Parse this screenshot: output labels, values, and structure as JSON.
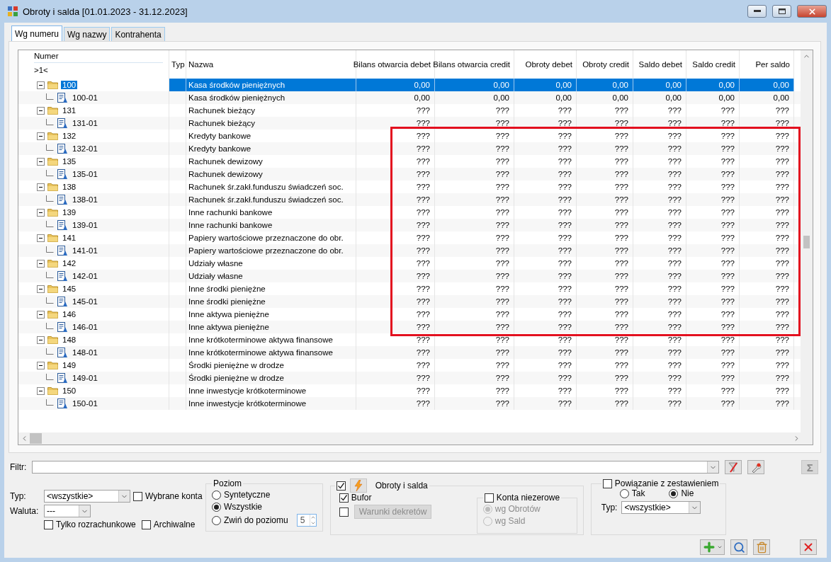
{
  "window": {
    "title": "Obroty i salda [01.01.2023 - 31.12.2023]"
  },
  "tabs": [
    {
      "label": "Wg numeru",
      "selected": true
    },
    {
      "label": "Wg nazwy",
      "selected": false
    },
    {
      "label": "Kontrahenta",
      "selected": false
    }
  ],
  "table": {
    "columns": [
      "Numer",
      "Typ",
      "Nazwa",
      "Bilans otwarcia debet",
      "Bilans otwarcia credit",
      "Obroty debet",
      "Obroty credit",
      "Saldo debet",
      "Saldo credit",
      "Per saldo"
    ],
    "number_filter": ">1<",
    "rows": [
      {
        "number": "100",
        "name": "Kasa środków pieniężnych",
        "values": [
          "0,00",
          "0,00",
          "0,00",
          "0,00",
          "0,00",
          "0,00",
          "0,00"
        ],
        "expanded": true,
        "selected": true,
        "highlighted": false,
        "children": [
          {
            "number": "100-01",
            "name": "Kasa środków pieniężnych",
            "values": [
              "0,00",
              "0,00",
              "0,00",
              "0,00",
              "0,00",
              "0,00",
              "0,00"
            ],
            "selected": false,
            "highlighted": false
          }
        ]
      },
      {
        "number": "131",
        "name": "Rachunek bieżący",
        "values": [
          "???",
          "???",
          "???",
          "???",
          "???",
          "???",
          "???"
        ],
        "expanded": true,
        "selected": false,
        "highlighted": false,
        "children": [
          {
            "number": "131-01",
            "name": "Rachunek bieżący",
            "values": [
              "???",
              "???",
              "???",
              "???",
              "???",
              "???",
              "???"
            ],
            "selected": false,
            "highlighted": false
          }
        ]
      },
      {
        "number": "132",
        "name": "Kredyty bankowe",
        "values": [
          "???",
          "???",
          "???",
          "???",
          "???",
          "???",
          "???"
        ],
        "expanded": true,
        "selected": false,
        "highlighted": true,
        "children": [
          {
            "number": "132-01",
            "name": "Kredyty bankowe",
            "values": [
              "???",
              "???",
              "???",
              "???",
              "???",
              "???",
              "???"
            ],
            "selected": false,
            "highlighted": true
          }
        ]
      },
      {
        "number": "135",
        "name": "Rachunek dewizowy",
        "values": [
          "???",
          "???",
          "???",
          "???",
          "???",
          "???",
          "???"
        ],
        "expanded": true,
        "selected": false,
        "highlighted": true,
        "children": [
          {
            "number": "135-01",
            "name": "Rachunek dewizowy",
            "values": [
              "???",
              "???",
              "???",
              "???",
              "???",
              "???",
              "???"
            ],
            "selected": false,
            "highlighted": true
          }
        ]
      },
      {
        "number": "138",
        "name": "Rachunek śr.zakł.funduszu świadczeń soc.",
        "values": [
          "???",
          "???",
          "???",
          "???",
          "???",
          "???",
          "???"
        ],
        "expanded": true,
        "selected": false,
        "highlighted": true,
        "children": [
          {
            "number": "138-01",
            "name": "Rachunek śr.zakł.funduszu świadczeń soc.",
            "values": [
              "???",
              "???",
              "???",
              "???",
              "???",
              "???",
              "???"
            ],
            "selected": false,
            "highlighted": true
          }
        ]
      },
      {
        "number": "139",
        "name": "Inne rachunki bankowe",
        "values": [
          "???",
          "???",
          "???",
          "???",
          "???",
          "???",
          "???"
        ],
        "expanded": true,
        "selected": false,
        "highlighted": true,
        "children": [
          {
            "number": "139-01",
            "name": "Inne rachunki bankowe",
            "values": [
              "???",
              "???",
              "???",
              "???",
              "???",
              "???",
              "???"
            ],
            "selected": false,
            "highlighted": true
          }
        ]
      },
      {
        "number": "141",
        "name": "Papiery wartościowe przeznaczone do obr.",
        "values": [
          "???",
          "???",
          "???",
          "???",
          "???",
          "???",
          "???"
        ],
        "expanded": true,
        "selected": false,
        "highlighted": true,
        "children": [
          {
            "number": "141-01",
            "name": "Papiery wartościowe przeznaczone do obr.",
            "values": [
              "???",
              "???",
              "???",
              "???",
              "???",
              "???",
              "???"
            ],
            "selected": false,
            "highlighted": true
          }
        ]
      },
      {
        "number": "142",
        "name": "Udziały własne",
        "values": [
          "???",
          "???",
          "???",
          "???",
          "???",
          "???",
          "???"
        ],
        "expanded": true,
        "selected": false,
        "highlighted": true,
        "children": [
          {
            "number": "142-01",
            "name": "Udziały własne",
            "values": [
              "???",
              "???",
              "???",
              "???",
              "???",
              "???",
              "???"
            ],
            "selected": false,
            "highlighted": true
          }
        ]
      },
      {
        "number": "145",
        "name": "Inne środki pieniężne",
        "values": [
          "???",
          "???",
          "???",
          "???",
          "???",
          "???",
          "???"
        ],
        "expanded": true,
        "selected": false,
        "highlighted": true,
        "children": [
          {
            "number": "145-01",
            "name": "Inne środki pieniężne",
            "values": [
              "???",
              "???",
              "???",
              "???",
              "???",
              "???",
              "???"
            ],
            "selected": false,
            "highlighted": true
          }
        ]
      },
      {
        "number": "146",
        "name": "Inne aktywa pieniężne",
        "values": [
          "???",
          "???",
          "???",
          "???",
          "???",
          "???",
          "???"
        ],
        "expanded": true,
        "selected": false,
        "highlighted": true,
        "children": [
          {
            "number": "146-01",
            "name": "Inne aktywa pieniężne",
            "values": [
              "???",
              "???",
              "???",
              "???",
              "???",
              "???",
              "???"
            ],
            "selected": false,
            "highlighted": true
          }
        ]
      },
      {
        "number": "148",
        "name": "Inne krótkoterminowe aktywa finansowe",
        "values": [
          "???",
          "???",
          "???",
          "???",
          "???",
          "???",
          "???"
        ],
        "expanded": true,
        "selected": false,
        "highlighted": false,
        "children": [
          {
            "number": "148-01",
            "name": "Inne krótkoterminowe aktywa finansowe",
            "values": [
              "???",
              "???",
              "???",
              "???",
              "???",
              "???",
              "???"
            ],
            "selected": false,
            "highlighted": false
          }
        ]
      },
      {
        "number": "149",
        "name": "Środki pieniężne w drodze",
        "values": [
          "???",
          "???",
          "???",
          "???",
          "???",
          "???",
          "???"
        ],
        "expanded": true,
        "selected": false,
        "highlighted": false,
        "children": [
          {
            "number": "149-01",
            "name": "Środki pieniężne w drodze",
            "values": [
              "???",
              "???",
              "???",
              "???",
              "???",
              "???",
              "???"
            ],
            "selected": false,
            "highlighted": false
          }
        ]
      },
      {
        "number": "150",
        "name": "Inne inwestycje krótkoterminowe",
        "values": [
          "???",
          "???",
          "???",
          "???",
          "???",
          "???",
          "???"
        ],
        "expanded": true,
        "selected": false,
        "highlighted": false,
        "children": [
          {
            "number": "150-01",
            "name": "Inne inwestycje krótkoterminowe",
            "values": [
              "???",
              "???",
              "???",
              "???",
              "???",
              "???",
              "???"
            ],
            "selected": false,
            "highlighted": false
          }
        ]
      }
    ]
  },
  "filter": {
    "label": "Filtr:"
  },
  "sum_button": "Σ",
  "type": {
    "label": "Typ:",
    "value": "<wszystkie>"
  },
  "currency": {
    "label": "Waluta:",
    "value": "---"
  },
  "selected_accounts": {
    "label": "Wybrane konta",
    "checked": false
  },
  "options": [
    {
      "label": "Tylko rozrachunkowe",
      "checked": false
    },
    {
      "label": "Archiwalne",
      "checked": false
    }
  ],
  "level_group": {
    "title": "Poziom",
    "options": [
      {
        "label": "Syntetyczne",
        "selected": false
      },
      {
        "label": "Wszystkie",
        "selected": true
      },
      {
        "label": "Zwiń do poziomu",
        "selected": false
      }
    ],
    "spin_value": "5"
  },
  "turnover": {
    "label": "Obroty i salda",
    "checked": true,
    "bufor": {
      "label": "Bufor",
      "checked": true
    },
    "conditions": {
      "checked": false,
      "button": "Warunki dekretów",
      "disabled": true
    },
    "nonzero": {
      "label": "Konta niezerowe",
      "checked": false,
      "options": [
        {
          "label": "wg Obrotów",
          "selected": true,
          "disabled": true
        },
        {
          "label": "wg Sald",
          "selected": false,
          "disabled": true
        }
      ]
    }
  },
  "link": {
    "label": "Powiązanie z zestawieniem",
    "checked": false,
    "options": [
      {
        "label": "Tak",
        "selected": false
      },
      {
        "label": "Nie",
        "selected": true
      }
    ],
    "type_label": "Typ:",
    "type_value": "<wszystkie>"
  }
}
